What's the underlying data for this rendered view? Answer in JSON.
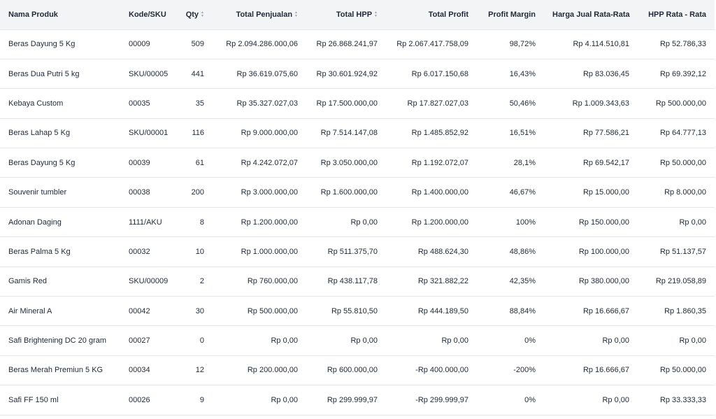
{
  "table": {
    "columns": [
      {
        "label": "Nama Produk",
        "sortable": false
      },
      {
        "label": "Kode/SKU",
        "sortable": false
      },
      {
        "label": "Qty",
        "sortable": true
      },
      {
        "label": "Total Penjualan",
        "sortable": true
      },
      {
        "label": "Total HPP",
        "sortable": true
      },
      {
        "label": "Total Profit",
        "sortable": false
      },
      {
        "label": "Profit Margin",
        "sortable": false
      },
      {
        "label": "Harga Jual Rata-Rata",
        "sortable": false
      },
      {
        "label": "HPP Rata - Rata",
        "sortable": false
      }
    ],
    "sort_icon": "sort-arrows-icon",
    "rows": [
      [
        "Beras Dayung 5 Kg",
        "00009",
        "509",
        "Rp 2.094.286.000,06",
        "Rp 26.868.241,97",
        "Rp 2.067.417.758,09",
        "98,72%",
        "Rp 4.114.510,81",
        "Rp 52.786,33"
      ],
      [
        "Beras Dua Putri 5 kg",
        "SKU/00005",
        "441",
        "Rp 36.619.075,60",
        "Rp 30.601.924,92",
        "Rp 6.017.150,68",
        "16,43%",
        "Rp 83.036,45",
        "Rp 69.392,12"
      ],
      [
        "Kebaya Custom",
        "00035",
        "35",
        "Rp 35.327.027,03",
        "Rp 17.500.000,00",
        "Rp 17.827.027,03",
        "50,46%",
        "Rp 1.009.343,63",
        "Rp 500.000,00"
      ],
      [
        "Beras Lahap 5 Kg",
        "SKU/00001",
        "116",
        "Rp 9.000.000,00",
        "Rp 7.514.147,08",
        "Rp 1.485.852,92",
        "16,51%",
        "Rp 77.586,21",
        "Rp 64.777,13"
      ],
      [
        "Beras Dayung 5 Kg",
        "00039",
        "61",
        "Rp 4.242.072,07",
        "Rp 3.050.000,00",
        "Rp 1.192.072,07",
        "28,1%",
        "Rp 69.542,17",
        "Rp 50.000,00"
      ],
      [
        "Souvenir tumbler",
        "00038",
        "200",
        "Rp 3.000.000,00",
        "Rp 1.600.000,00",
        "Rp 1.400.000,00",
        "46,67%",
        "Rp 15.000,00",
        "Rp 8.000,00"
      ],
      [
        "Adonan Daging",
        "1111/AKU",
        "8",
        "Rp 1.200.000,00",
        "Rp 0,00",
        "Rp 1.200.000,00",
        "100%",
        "Rp 150.000,00",
        "Rp 0,00"
      ],
      [
        "Beras Palma 5 Kg",
        "00032",
        "10",
        "Rp 1.000.000,00",
        "Rp 511.375,70",
        "Rp 488.624,30",
        "48,86%",
        "Rp 100.000,00",
        "Rp 51.137,57"
      ],
      [
        "Gamis Red",
        "SKU/00009",
        "2",
        "Rp 760.000,00",
        "Rp 438.117,78",
        "Rp 321.882,22",
        "42,35%",
        "Rp 380.000,00",
        "Rp 219.058,89"
      ],
      [
        "Air Mineral A",
        "00042",
        "30",
        "Rp 500.000,00",
        "Rp 55.810,50",
        "Rp 444.189,50",
        "88,84%",
        "Rp 16.666,67",
        "Rp 1.860,35"
      ],
      [
        "Safi Brightening DC 20 gram",
        "00027",
        "0",
        "Rp 0,00",
        "Rp 0,00",
        "Rp 0,00",
        "0%",
        "Rp 0,00",
        "Rp 0,00"
      ],
      [
        "Beras Merah Premiun 5 KG",
        "00034",
        "12",
        "Rp 200.000,00",
        "Rp 600.000,00",
        "-Rp 400.000,00",
        "-200%",
        "Rp 16.666,67",
        "Rp 50.000,00"
      ],
      [
        "Safi FF 150 ml",
        "00026",
        "9",
        "Rp 0,00",
        "Rp 299.999,97",
        "-Rp 299.999,97",
        "0%",
        "Rp 0,00",
        "Rp 33.333,33"
      ]
    ]
  }
}
